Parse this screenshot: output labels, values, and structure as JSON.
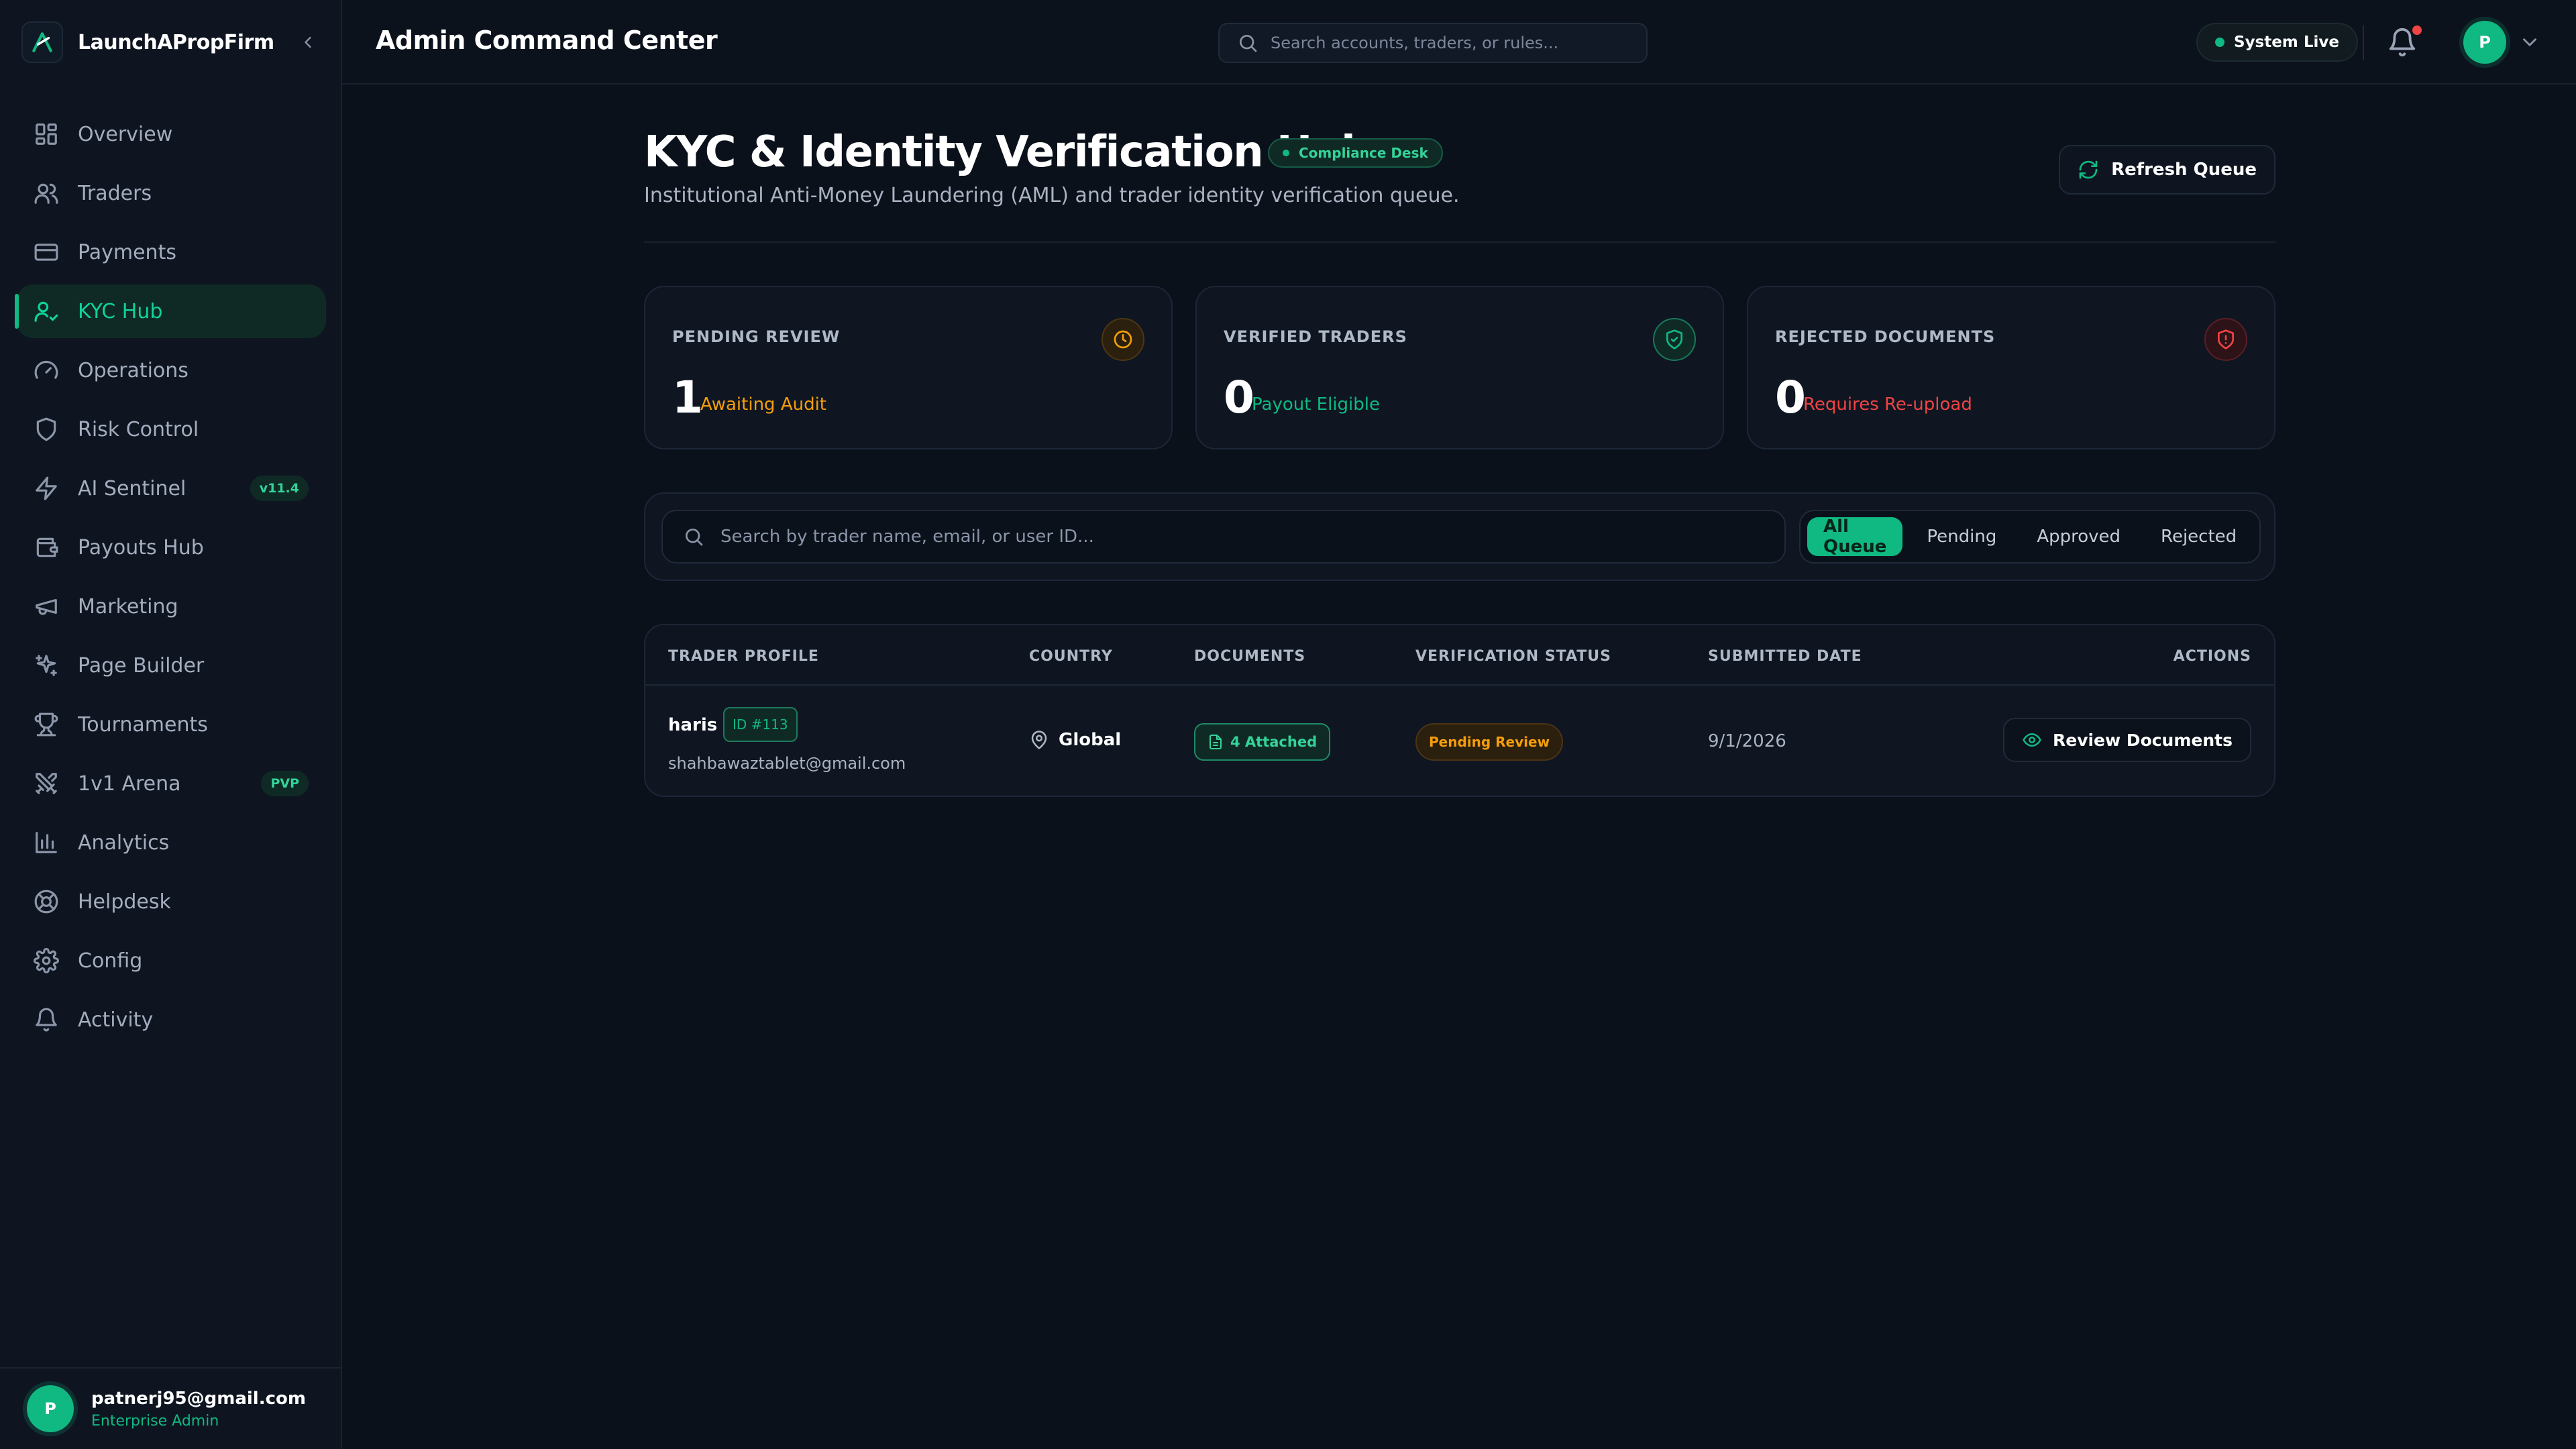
{
  "brand": {
    "name": "LaunchAPropFirm"
  },
  "sidebar": {
    "items": [
      {
        "label": "Overview",
        "icon": "grid-icon"
      },
      {
        "label": "Traders",
        "icon": "users-icon"
      },
      {
        "label": "Payments",
        "icon": "credit-card-icon"
      },
      {
        "label": "KYC Hub",
        "icon": "user-check-icon",
        "active": true
      },
      {
        "label": "Operations",
        "icon": "gauge-icon"
      },
      {
        "label": "Risk Control",
        "icon": "shield-icon"
      },
      {
        "label": "AI Sentinel",
        "icon": "zap-icon",
        "badge": "v11.4"
      },
      {
        "label": "Payouts Hub",
        "icon": "wallet-icon"
      },
      {
        "label": "Marketing",
        "icon": "megaphone-icon"
      },
      {
        "label": "Page Builder",
        "icon": "sparkles-icon"
      },
      {
        "label": "Tournaments",
        "icon": "trophy-icon"
      },
      {
        "label": "1v1 Arena",
        "icon": "swords-icon",
        "badge": "PVP"
      },
      {
        "label": "Analytics",
        "icon": "bar-chart-icon"
      },
      {
        "label": "Helpdesk",
        "icon": "life-buoy-icon"
      },
      {
        "label": "Config",
        "icon": "gear-icon"
      },
      {
        "label": "Activity",
        "icon": "bell-icon"
      }
    ],
    "user": {
      "initial": "P",
      "email": "patnerj95@gmail.com",
      "role": "Enterprise Admin"
    }
  },
  "header": {
    "title": "Admin Command Center",
    "search_placeholder": "Search accounts, traders, or rules...",
    "system_status": "System Live",
    "avatar_initial": "P"
  },
  "page": {
    "title": "KYC & Identity Verification Hub",
    "badge": "Compliance Desk",
    "subtitle": "Institutional Anti-Money Laundering (AML) and trader identity verification queue.",
    "refresh_label": "Refresh Queue"
  },
  "stats": [
    {
      "label": "PENDING REVIEW",
      "value": "1",
      "sub": "Awaiting Audit",
      "color": "#f59e0b",
      "icon": "clock-icon"
    },
    {
      "label": "VERIFIED TRADERS",
      "value": "0",
      "sub": "Payout Eligible",
      "color": "#10b981",
      "icon": "shield-check-icon"
    },
    {
      "label": "REJECTED DOCUMENTS",
      "value": "0",
      "sub": "Requires Re-upload",
      "color": "#ef4444",
      "icon": "shield-alert-icon"
    }
  ],
  "filters": {
    "search_placeholder": "Search by trader name, email, or user ID...",
    "tabs": [
      "All Queue",
      "Pending",
      "Approved",
      "Rejected"
    ],
    "active_tab": "All Queue"
  },
  "table": {
    "columns": [
      "TRADER PROFILE",
      "COUNTRY",
      "DOCUMENTS",
      "VERIFICATION STATUS",
      "SUBMITTED DATE",
      "ACTIONS"
    ],
    "rows": [
      {
        "name": "haris",
        "id": "ID #113",
        "email": "shahbawaztablet@gmail.com",
        "country": "Global",
        "documents": "4 Attached",
        "status": "Pending Review",
        "submitted": "9/1/2026",
        "action": "Review Documents"
      }
    ]
  }
}
